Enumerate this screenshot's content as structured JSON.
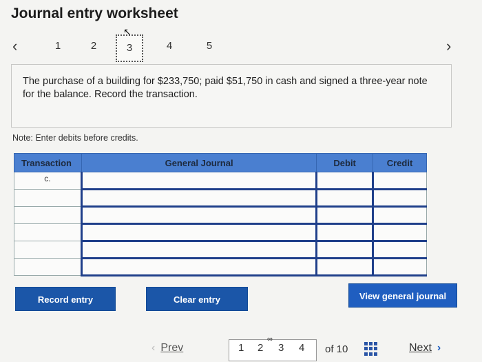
{
  "header": {
    "title": "Journal entry worksheet"
  },
  "steps": {
    "prev_icon": "chevron-left-icon",
    "next_icon": "chevron-right-icon",
    "items": [
      "1",
      "2",
      "3",
      "4",
      "5"
    ],
    "active": "3"
  },
  "problem": {
    "text": "The purchase of a building for $233,750; paid $51,750 in cash and signed a three-year note for the balance. Record the transaction."
  },
  "note": "Note: Enter debits before credits.",
  "journal": {
    "headers": {
      "transaction": "Transaction",
      "general_journal": "General Journal",
      "debit": "Debit",
      "credit": "Credit"
    },
    "rows": [
      {
        "transaction": "c.",
        "account": "",
        "debit": "",
        "credit": ""
      },
      {
        "transaction": "",
        "account": "",
        "debit": "",
        "credit": ""
      },
      {
        "transaction": "",
        "account": "",
        "debit": "",
        "credit": ""
      },
      {
        "transaction": "",
        "account": "",
        "debit": "",
        "credit": ""
      },
      {
        "transaction": "",
        "account": "",
        "debit": "",
        "credit": ""
      },
      {
        "transaction": "",
        "account": "",
        "debit": "",
        "credit": ""
      }
    ]
  },
  "buttons": {
    "record": "Record entry",
    "clear": "Clear entry",
    "view": "View general journal"
  },
  "pager": {
    "prev": "Prev",
    "pages": [
      "1",
      "2",
      "3",
      "4"
    ],
    "of": "of 10",
    "next": "Next",
    "colors": {
      "accent": "#1f5ec0",
      "header": "#4a7fd0"
    }
  }
}
